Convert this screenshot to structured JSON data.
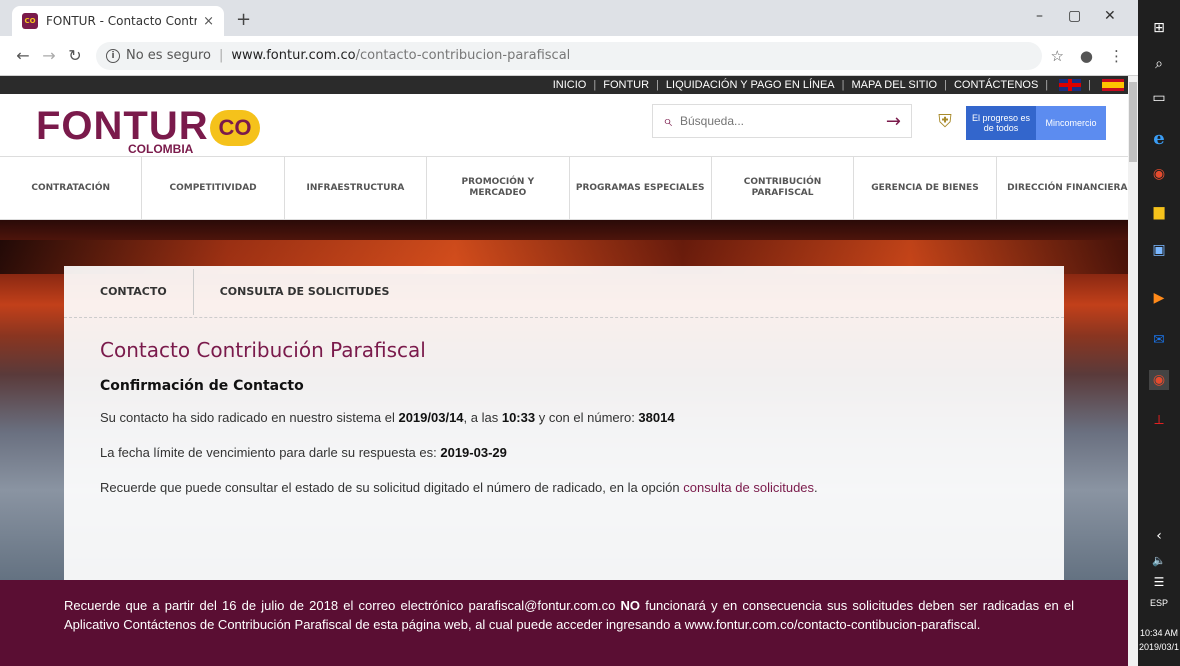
{
  "browser": {
    "tab_title": "FONTUR - Contacto Contribución",
    "tab_close": "×",
    "new_tab": "+",
    "security_label": "No es seguro",
    "url_domain": "www.fontur.com.co",
    "url_path": "/contacto-contribucion-parafiscal",
    "window_controls": [
      "–",
      "▢",
      "✕"
    ]
  },
  "topnav": {
    "items": [
      "INICIO",
      "FONTUR",
      "LIQUIDACIÓN Y PAGO EN LÍNEA",
      "MAPA DEL SITIO",
      "CONTÁCTENOS"
    ]
  },
  "header": {
    "logo_word": "FONTUR",
    "logo_country": "COLOMBIA",
    "logo_mark": "CO",
    "search_placeholder": "Búsqueda...",
    "gov_left": "El progreso es de todos",
    "gov_right": "Mincomercio"
  },
  "mainnav": {
    "items": [
      "CONTRATACIÓN",
      "COMPETITIVIDAD",
      "INFRAESTRUCTURA",
      "PROMOCIÓN Y MERCADEO",
      "PROGRAMAS ESPECIALES",
      "CONTRIBUCIÓN PARAFISCAL",
      "GERENCIA DE BIENES",
      "DIRECCIÓN FINANCIERA"
    ]
  },
  "subtabs": {
    "contacto": "CONTACTO",
    "consulta": "CONSULTA DE SOLICITUDES"
  },
  "content": {
    "title": "Contacto Contribución Parafiscal",
    "confirm_title": "Confirmación de Contacto",
    "line1_pre": "Su contacto ha sido radicado en nuestro sistema el ",
    "line1_date": "2019/03/14",
    "line1_mid": ", a las ",
    "line1_time": "10:33",
    "line1_mid2": " y con el número: ",
    "line1_number": "38014",
    "line2_pre": "La fecha límite de vencimiento para darle su respuesta es: ",
    "line2_date": "2019-03-29",
    "line3_pre": "Recuerde que puede consultar el estado de su solicitud digitado el número de radicado, en la opción ",
    "line3_link": "consulta de solicitudes",
    "line3_post": "."
  },
  "footer": {
    "part1": "Recuerde que a partir del 16 de julio de 2018 el correo electrónico parafiscal@fontur.com.co ",
    "bold": "NO",
    "part2": " funcionará y en consecuencia sus solicitudes deben ser radicadas en el Aplicativo Contáctenos de Contribución Parafiscal de esta página web, al cual puede acceder ingresando a www.fontur.com.co/contacto-contibucion-parafiscal."
  },
  "taskbar": {
    "lang": "ESP",
    "time": "10:34 AM",
    "date": "2019/03/1"
  },
  "colors": {
    "brand": "#7a1a4b",
    "footer_bg": "#5a0e33",
    "accent_yellow": "#f5c21b"
  }
}
